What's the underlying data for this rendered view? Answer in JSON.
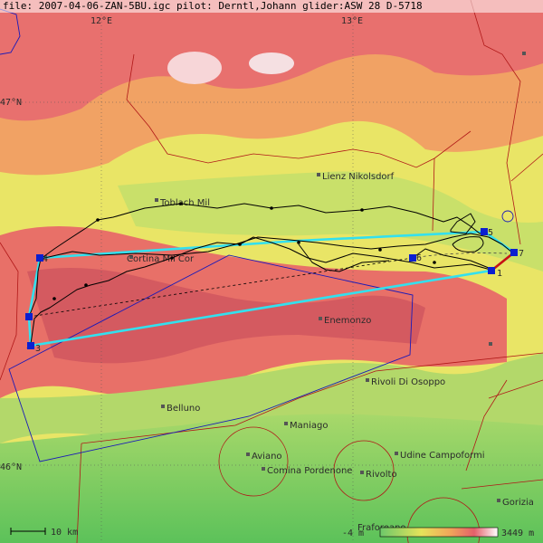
{
  "header": {
    "text": "file: 2007-04-06-ZAN-5BU.igc  pilot: Derntl,Johann glider:ASW 28 D-5718"
  },
  "grid": {
    "lon_12": "12°E",
    "lon_13": "13°E",
    "lat_47": "47°N",
    "lat_46": "46°N"
  },
  "towns": [
    {
      "name": "Lienz Nikolsdorf"
    },
    {
      "name": "Toblach Mil"
    },
    {
      "name": "Cortina Mil Cor"
    },
    {
      "name": "Enemonzo"
    },
    {
      "name": "Rivoli Di Osoppo"
    },
    {
      "name": "Belluno"
    },
    {
      "name": "Maniago"
    },
    {
      "name": "Aviano"
    },
    {
      "name": "Comina Pordenone"
    },
    {
      "name": "Udine Campoformi"
    },
    {
      "name": "Rivolto"
    },
    {
      "name": "Gorizia"
    },
    {
      "name": "Fraforeano"
    }
  ],
  "turnpoints": [
    "1",
    "3",
    "4",
    "5",
    "6",
    "7"
  ],
  "scale": {
    "label": "10 km"
  },
  "legend": {
    "min": "-4 m",
    "max": "3449 m"
  },
  "colors": {
    "task": "#33e0ee",
    "track": "#000000",
    "airspace_blue": "#1a1ab8",
    "airspace_red": "#b01818",
    "turnpoint": "#0b1fd0"
  }
}
